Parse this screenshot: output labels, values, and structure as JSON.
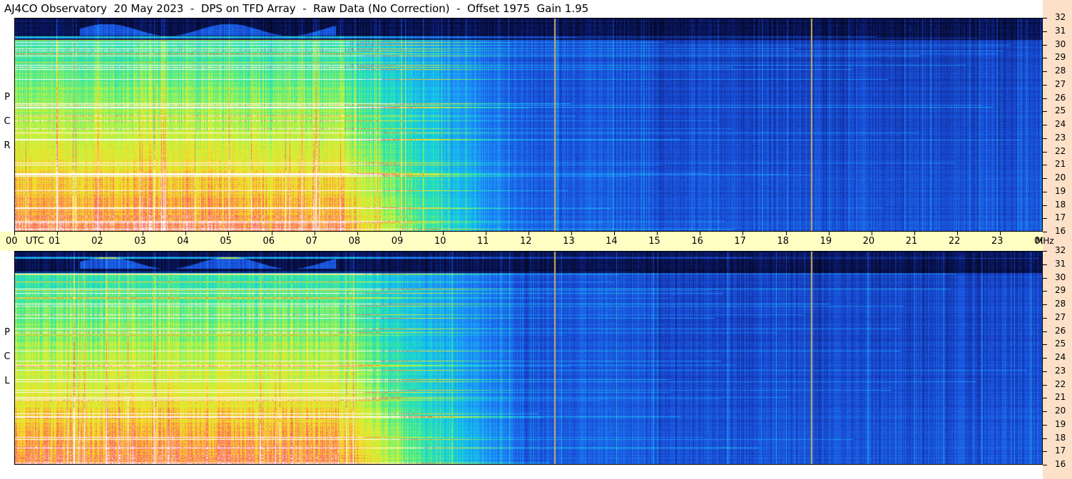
{
  "title": "AJ4CO Observatory  20 May 2023  -  DPS on TFD Array  -  Raw Data (No Correction)  -  Offset 1975  Gain 1.95",
  "panels": {
    "rcp": {
      "label": [
        "R",
        "C",
        "P"
      ]
    },
    "lcp": {
      "label": [
        "L",
        "C",
        "P"
      ]
    }
  },
  "colors": {
    "time_axis_bg": "#ffffc4",
    "freq_axis_bg": "#fde0c8",
    "marker_line": "#c8b46a"
  },
  "chart_data": {
    "type": "heatmap",
    "x_axis": {
      "unit_label": "UTC",
      "range_hours": [
        0,
        24
      ],
      "tick_labels": [
        "00",
        "01",
        "02",
        "03",
        "04",
        "05",
        "06",
        "07",
        "08",
        "09",
        "10",
        "11",
        "12",
        "13",
        "14",
        "15",
        "16",
        "17",
        "18",
        "19",
        "20",
        "21",
        "22",
        "23",
        "00"
      ]
    },
    "y_axis": {
      "unit_label": "MHz",
      "range_mhz": [
        16,
        32
      ],
      "tick_labels": [
        "32",
        "31",
        "30",
        "29",
        "28",
        "27",
        "26",
        "25",
        "24",
        "23",
        "22",
        "21",
        "20",
        "19",
        "18",
        "17",
        "16"
      ]
    },
    "vertical_markers_utc": [
      12.6,
      18.6
    ],
    "series": [
      {
        "name": "RCP",
        "panel": "rcp"
      },
      {
        "name": "LCP",
        "panel": "lcp"
      }
    ]
  }
}
